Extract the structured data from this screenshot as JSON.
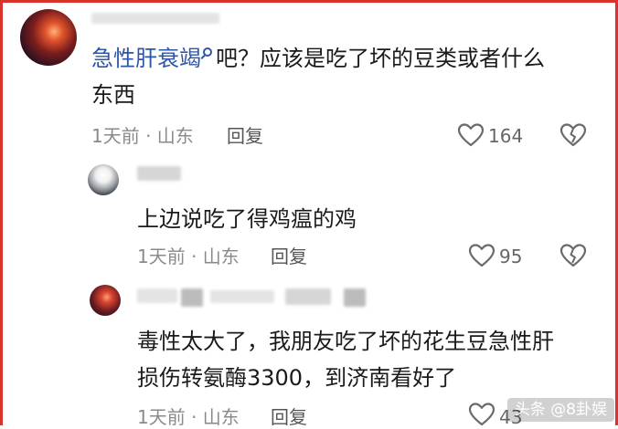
{
  "comments": [
    {
      "user_link": "急性肝衰竭",
      "text_line1_rest": "吧？应该是吃了坏的豆类或者什么",
      "text_line2": "东西",
      "meta": "1天前 · 山东",
      "reply_label": "回复",
      "like_count": "164"
    },
    {
      "text": "上边说吃了得鸡瘟的鸡",
      "meta": "1天前 · 山东",
      "reply_label": "回复",
      "like_count": "95"
    },
    {
      "text_line1": "毒性太大了，我朋友吃了坏的花生豆急性肝",
      "text_line2": "损伤转氨酶3300，到济南看好了",
      "meta": "1天前 · 山东",
      "reply_label": "回复",
      "like_count": "43"
    }
  ],
  "watermark": "头条 @8卦娱",
  "colors": {
    "frame": "#d9342b",
    "link": "#2e56a8",
    "meta": "#8a8a8a",
    "text": "#1a1a1a"
  },
  "icons": [
    "heart-icon",
    "dislike-heart-icon",
    "search-icon"
  ]
}
